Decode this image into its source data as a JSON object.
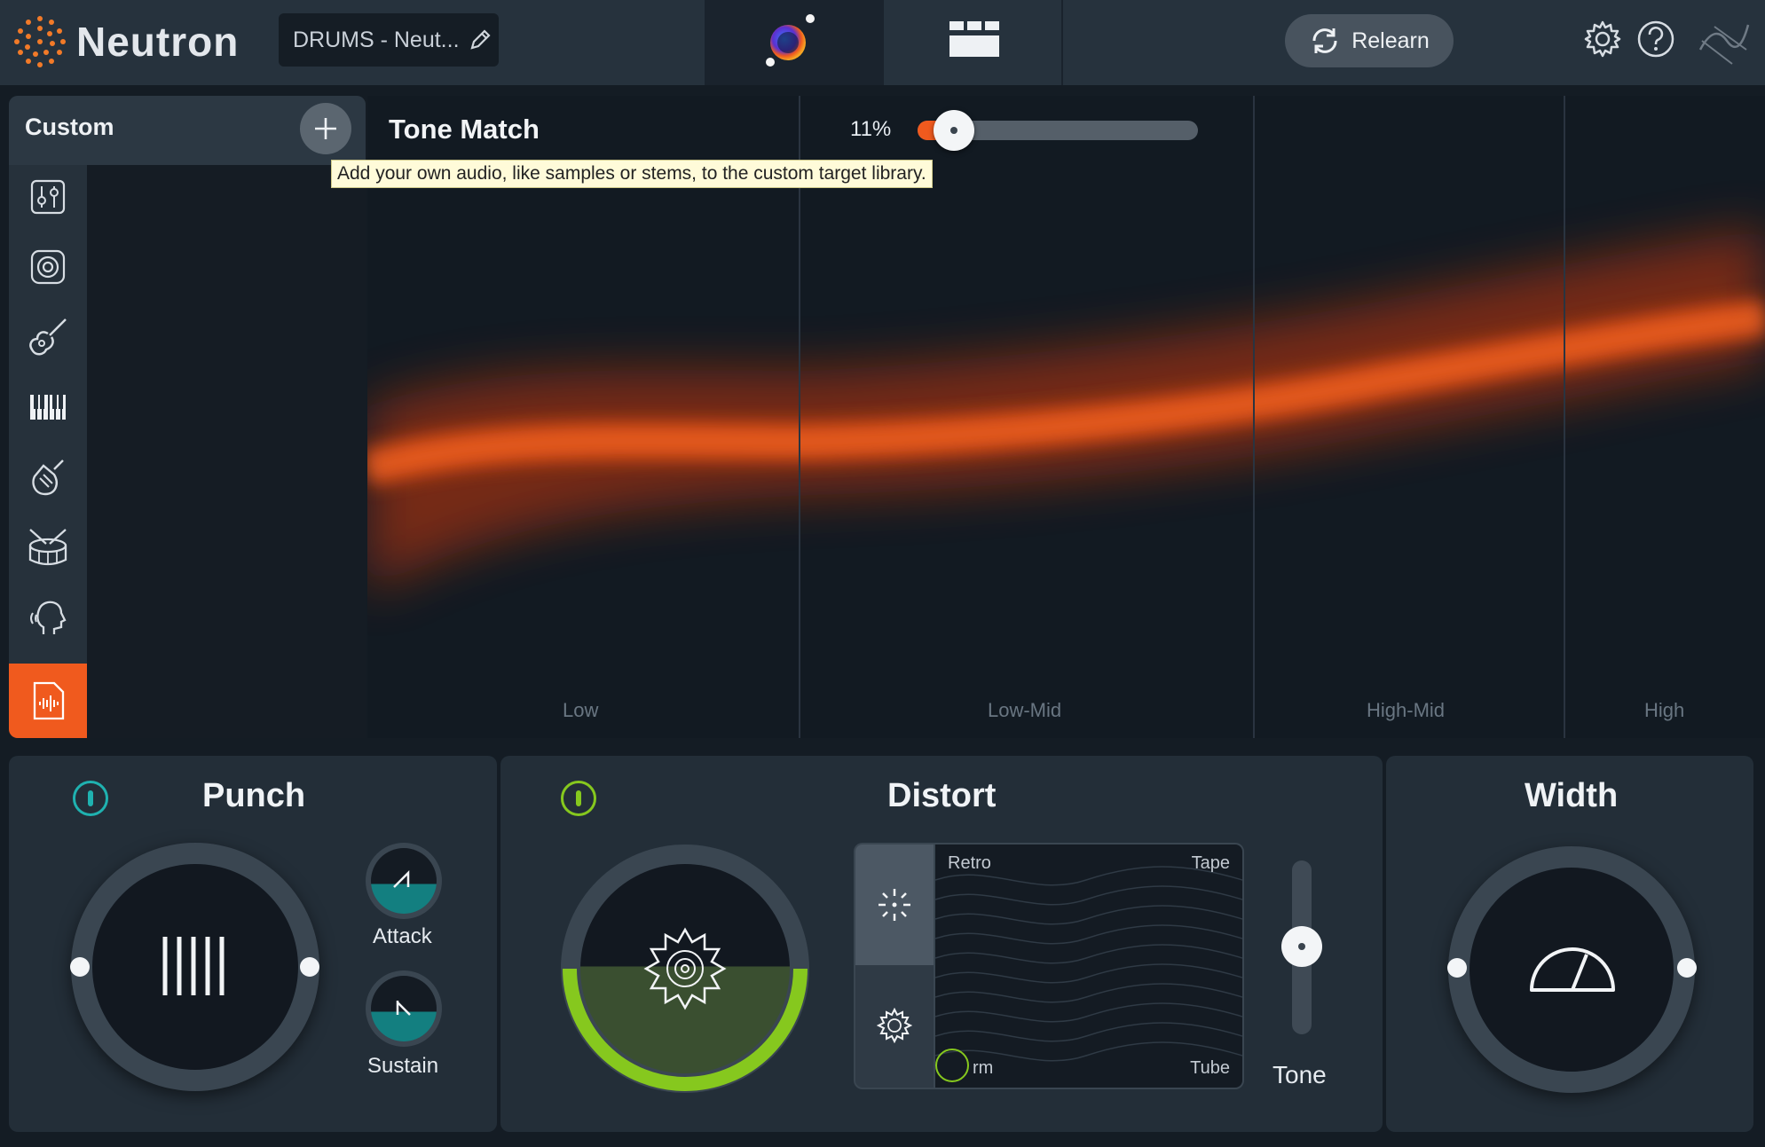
{
  "header": {
    "app_title": "Neutron",
    "preset_name": "DRUMS - Neut...",
    "relearn_label": "Relearn"
  },
  "side_panel": {
    "title": "Custom",
    "categories": [
      "mixer",
      "speaker",
      "guitar",
      "keys",
      "brass",
      "drums",
      "vocal",
      "custom-file"
    ],
    "active_category": "custom-file"
  },
  "tone_match": {
    "title": "Tone Match",
    "amount": "11%",
    "amount_value": 0.11,
    "tooltip": "Add your own audio, like samples or stems, to the custom target library.",
    "bands": [
      "Low",
      "Low-Mid",
      "High-Mid",
      "High"
    ]
  },
  "modules": {
    "punch": {
      "title": "Punch",
      "attack_label": "Attack",
      "sustain_label": "Sustain"
    },
    "distort": {
      "title": "Distort",
      "corners": {
        "top_left": "Retro",
        "top_right": "Tape",
        "bottom_left": "rm",
        "bottom_right": "Tube"
      },
      "tone_label": "Tone"
    },
    "width": {
      "title": "Width"
    }
  },
  "colors": {
    "accent": "#f05a1e",
    "punch_teal": "#1fb2b0",
    "distort_green": "#86c81e",
    "background": "#141c24"
  }
}
